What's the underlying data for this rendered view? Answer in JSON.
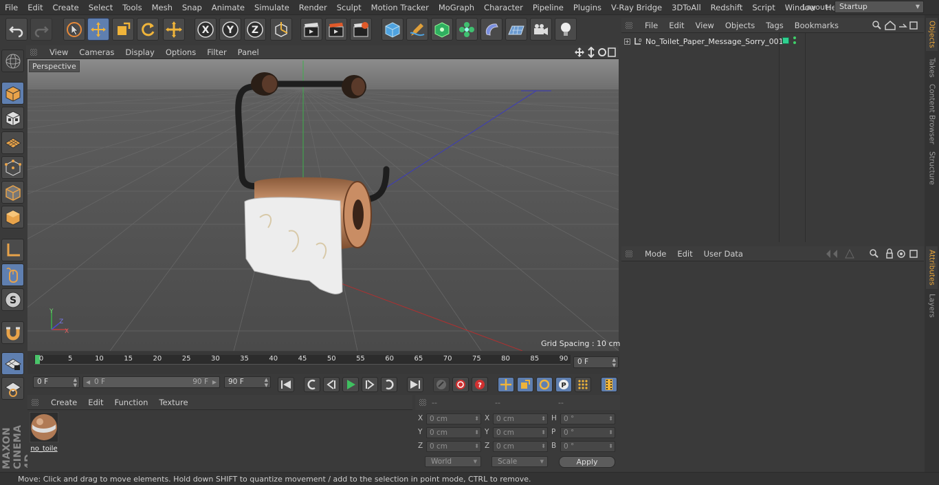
{
  "menubar": {
    "items": [
      "File",
      "Edit",
      "Create",
      "Select",
      "Tools",
      "Mesh",
      "Snap",
      "Animate",
      "Simulate",
      "Render",
      "Sculpt",
      "Motion Tracker",
      "MoGraph",
      "Character",
      "Pipeline",
      "Plugins",
      "V-Ray Bridge",
      "3DToAll",
      "Redshift",
      "Script",
      "Window",
      "Help"
    ],
    "layout_label": "Layout:",
    "layout_value": "Startup"
  },
  "viewport": {
    "menu": [
      "View",
      "Cameras",
      "Display",
      "Options",
      "Filter",
      "Panel"
    ],
    "label": "Perspective",
    "grid_spacing": "Grid Spacing : 10 cm"
  },
  "timeline": {
    "ticks": [
      "0",
      "5",
      "10",
      "15",
      "20",
      "25",
      "30",
      "35",
      "40",
      "45",
      "50",
      "55",
      "60",
      "65",
      "70",
      "75",
      "80",
      "85",
      "90"
    ],
    "current_frame": "0 F",
    "start_field": "0 F",
    "range_start": "0 F",
    "range_end": "90 F",
    "end_field": "90 F"
  },
  "material_manager": {
    "menu": [
      "Create",
      "Edit",
      "Function",
      "Texture"
    ],
    "materials": [
      {
        "name": "no_toile"
      }
    ]
  },
  "coordinates": {
    "headers": [
      "--",
      "--",
      "--"
    ],
    "rows": [
      {
        "l1": "X",
        "v1": "0 cm",
        "l2": "X",
        "v2": "0 cm",
        "l3": "H",
        "v3": "0 °"
      },
      {
        "l1": "Y",
        "v1": "0 cm",
        "l2": "Y",
        "v2": "0 cm",
        "l3": "P",
        "v3": "0 °"
      },
      {
        "l1": "Z",
        "v1": "0 cm",
        "l2": "Z",
        "v2": "0 cm",
        "l3": "B",
        "v3": "0 °"
      }
    ],
    "world": "World",
    "scale": "Scale",
    "apply": "Apply"
  },
  "object_manager": {
    "menu": [
      "File",
      "Edit",
      "View",
      "Objects",
      "Tags",
      "Bookmarks"
    ],
    "objects": [
      {
        "name": "No_Toilet_Paper_Message_Sorry_001"
      }
    ]
  },
  "attribute_manager": {
    "menu": [
      "Mode",
      "Edit",
      "User Data"
    ]
  },
  "side_tabs": [
    "Objects",
    "Takes",
    "Content Browser",
    "Structure",
    "Attributes",
    "Layers"
  ],
  "status": "Move: Click and drag to move elements. Hold down SHIFT to quantize movement / add to the selection in point mode, CTRL to remove.",
  "brand": "MAXON CINEMA 4D",
  "colors": {
    "accent": "#5f7fb0",
    "tab_active": "#e8a53a",
    "viewport_bg": "#5b5b5b",
    "timeline_marker": "#49c46a"
  }
}
